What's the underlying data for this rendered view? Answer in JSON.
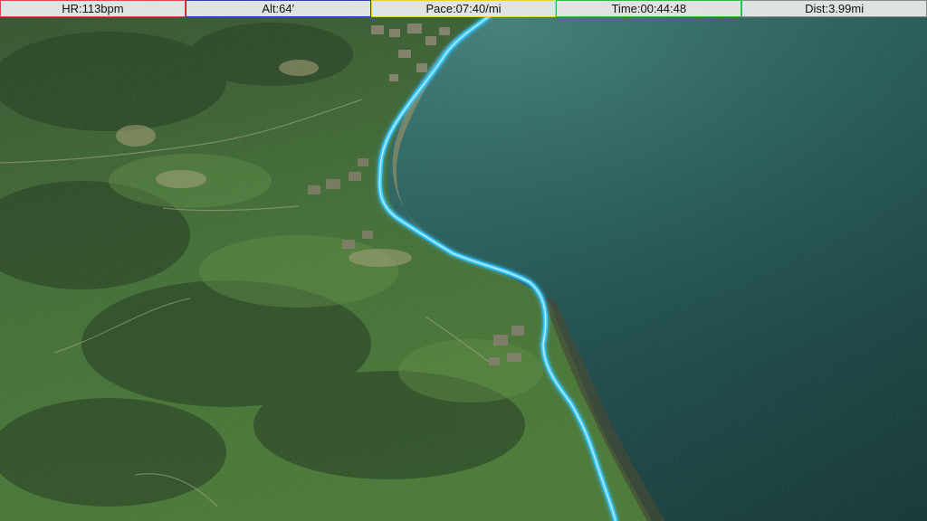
{
  "stats": [
    {
      "id": "hr",
      "label": "HR:113bpm",
      "border_color": "#e0474c"
    },
    {
      "id": "alt",
      "label": "Alt:64′",
      "border_color": "#2f3fb5"
    },
    {
      "id": "pace",
      "label": "Pace:07:40/mi",
      "border_color": "#e8d22b"
    },
    {
      "id": "time",
      "label": "Time:00:44:48",
      "border_color": "#2fbf3a"
    },
    {
      "id": "dist",
      "label": "Dist:3.99mi",
      "border_color": "#8a8a8a"
    }
  ],
  "colors": {
    "route": "#39c6ff",
    "route_glow": "#bff0ff",
    "sea_dark": "#0f3b38",
    "sea_light": "#2c6b66",
    "land_dark": "#1f3b1c",
    "land_light": "#4f7a3a"
  },
  "map": {
    "view": "3d-satellite-terrain",
    "route_icon": "route-line"
  }
}
